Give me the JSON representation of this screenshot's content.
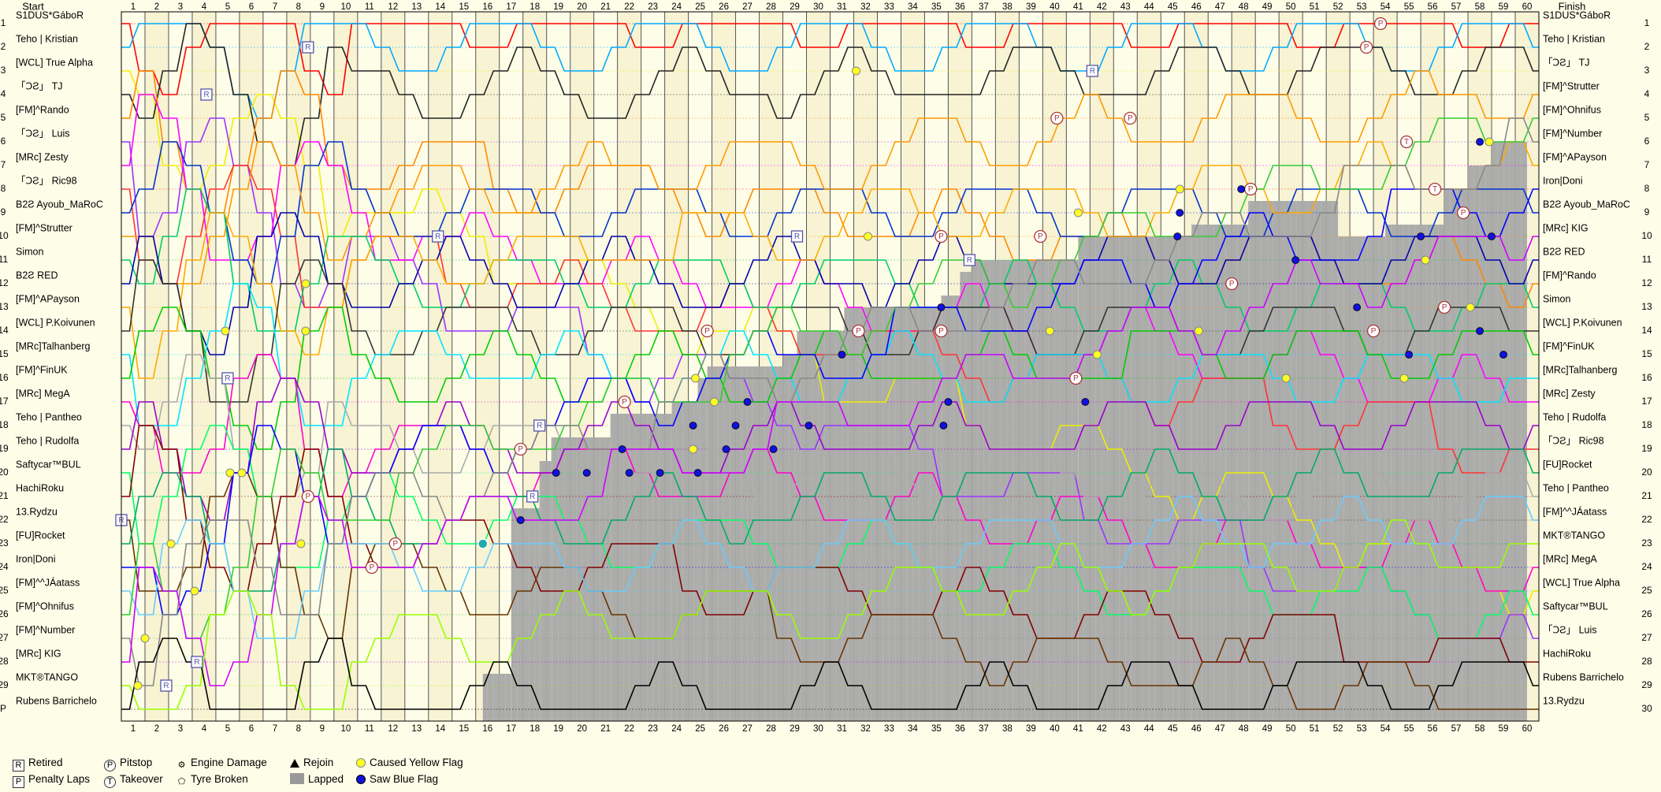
{
  "chart_data": {
    "type": "line",
    "title": "",
    "start_label": "Start",
    "finish_label": "Finish",
    "laps": 60,
    "positions": 30,
    "position_labels": [
      "1",
      "2",
      "3",
      "4",
      "5",
      "6",
      "7",
      "8",
      "9",
      "10",
      "11",
      "12",
      "13",
      "14",
      "15",
      "16",
      "17",
      "18",
      "19",
      "20",
      "21",
      "22",
      "23",
      "24",
      "25",
      "26",
      "27",
      "28",
      "29",
      "P"
    ],
    "start_grid": [
      "S1DUS*GáboR",
      "Teho | Kristian",
      "[WCL] True Alpha",
      "「ↃƧ」 TJ",
      "[FM]^Rando",
      "「ↃƧ」 Luis",
      "[MRc] Zesty",
      "「ↃƧ」 Ric98",
      "B2Ƨ Ayoub_MaRoC",
      "[FM]^Strutter",
      "Simon",
      "B2Ƨ RED",
      "[FM]^APayson",
      "[WCL] P.Koivunen",
      "[MRc]Talhanberg",
      "[FM]^FinUK",
      "[MRc] MegA",
      "Teho | Pantheo",
      "Teho | Rudolfa",
      "Saftycar™BUL",
      "HachiRoku",
      "13.Rydzu",
      "[FU]Rocket",
      "Iron|Doni",
      "[FM]^^JÁatass",
      "[FM]^Ohnifus",
      "[FM]^Number",
      "[MRc] KIG",
      "MKT®TANGO",
      "Rubens Barrichelo"
    ],
    "finish": [
      {
        "name": "S1DUS*GáboR",
        "pos": "1"
      },
      {
        "name": "Teho | Kristian",
        "pos": "2"
      },
      {
        "name": "「ↃƧ」 TJ",
        "pos": "3"
      },
      {
        "name": "[FM]^Strutter",
        "pos": "4"
      },
      {
        "name": "[FM]^Ohnifus",
        "pos": "5"
      },
      {
        "name": "[FM]^Number",
        "pos": "6"
      },
      {
        "name": "[FM]^APayson",
        "pos": "7"
      },
      {
        "name": "Iron|Doni",
        "pos": "8"
      },
      {
        "name": "B2Ƨ Ayoub_MaRoC",
        "pos": "9"
      },
      {
        "name": "[MRc] KIG",
        "pos": "10"
      },
      {
        "name": "B2Ƨ RED",
        "pos": "11"
      },
      {
        "name": "[FM]^Rando",
        "pos": "12"
      },
      {
        "name": "Simon",
        "pos": "13"
      },
      {
        "name": "[WCL] P.Koivunen",
        "pos": "14"
      },
      {
        "name": "[FM]^FinUK",
        "pos": "15"
      },
      {
        "name": "[MRc]Talhanberg",
        "pos": "16"
      },
      {
        "name": "[MRc] Zesty",
        "pos": "17"
      },
      {
        "name": "Teho | Rudolfa",
        "pos": "18"
      },
      {
        "name": "「ↃƧ」 Ric98",
        "pos": "19"
      },
      {
        "name": "[FU]Rocket",
        "pos": "20"
      },
      {
        "name": "Teho | Pantheo",
        "pos": "21"
      },
      {
        "name": "[FM]^^JÁatass",
        "pos": "22"
      },
      {
        "name": "MKT®TANGO",
        "pos": "23"
      },
      {
        "name": "[MRc] MegA",
        "pos": "24"
      },
      {
        "name": "[WCL] True Alpha",
        "pos": "25"
      },
      {
        "name": "Saftycar™BUL",
        "pos": "26"
      },
      {
        "name": "「ↃƧ」 Luis",
        "pos": "27"
      },
      {
        "name": "HachiRoku",
        "pos": "28"
      },
      {
        "name": "Rubens Barrichelo",
        "pos": "29"
      },
      {
        "name": "13.Rydzu",
        "pos": "30"
      }
    ],
    "lapped_steps": [
      {
        "from_lap": 15.3,
        "depth": 2
      },
      {
        "from_lap": 16.5,
        "depth": 9
      },
      {
        "from_lap": 17.7,
        "depth": 11
      },
      {
        "from_lap": 18.2,
        "depth": 12
      },
      {
        "from_lap": 20.7,
        "depth": 13
      },
      {
        "from_lap": 23.3,
        "depth": 13.5
      },
      {
        "from_lap": 24.4,
        "depth": 14.5
      },
      {
        "from_lap": 24.8,
        "depth": 15
      },
      {
        "from_lap": 28.0,
        "depth": 15.5
      },
      {
        "from_lap": 28.6,
        "depth": 16.5
      },
      {
        "from_lap": 30.6,
        "depth": 17.5
      },
      {
        "from_lap": 34.7,
        "depth": 18
      },
      {
        "from_lap": 35.5,
        "depth": 19
      },
      {
        "from_lap": 36.0,
        "depth": 19.5
      },
      {
        "from_lap": 40.5,
        "depth": 20.5
      },
      {
        "from_lap": 45.3,
        "depth": 21
      },
      {
        "from_lap": 47.7,
        "depth": 22
      },
      {
        "from_lap": 51.5,
        "depth": 20.5
      },
      {
        "from_lap": 53.5,
        "depth": 21
      },
      {
        "from_lap": 56.0,
        "depth": 22.5
      },
      {
        "from_lap": 57.0,
        "depth": 23.5
      },
      {
        "from_lap": 58.0,
        "depth": 24.5
      },
      {
        "from_lap": 59.5,
        "depth": 0
      }
    ],
    "events": [
      {
        "type": "pitstop",
        "lap": 53.3,
        "pos": 1
      },
      {
        "type": "pitstop",
        "lap": 52.7,
        "pos": 2
      },
      {
        "type": "retired",
        "lap": 7.9,
        "pos": 2
      },
      {
        "type": "retired",
        "lap": 3.6,
        "pos": 4
      },
      {
        "type": "retired",
        "lap": 41.1,
        "pos": 3
      },
      {
        "type": "yellow",
        "lap": 31.1,
        "pos": 3
      },
      {
        "type": "pitstop",
        "lap": 39.6,
        "pos": 5
      },
      {
        "type": "pitstop",
        "lap": 42.7,
        "pos": 5
      },
      {
        "type": "takeover",
        "lap": 54.4,
        "pos": 6
      },
      {
        "type": "blue",
        "lap": 57.5,
        "pos": 6
      },
      {
        "type": "yellow",
        "lap": 57.9,
        "pos": 6
      },
      {
        "type": "pitstop",
        "lap": 47.8,
        "pos": 8
      },
      {
        "type": "blue",
        "lap": 47.4,
        "pos": 8
      },
      {
        "type": "yellow",
        "lap": 44.8,
        "pos": 8
      },
      {
        "type": "takeover",
        "lap": 55.6,
        "pos": 8
      },
      {
        "type": "yellow",
        "lap": 40.5,
        "pos": 9
      },
      {
        "type": "blue",
        "lap": 44.8,
        "pos": 9
      },
      {
        "type": "pitstop",
        "lap": 56.8,
        "pos": 9
      },
      {
        "type": "retired",
        "lap": 13.4,
        "pos": 10
      },
      {
        "type": "retired",
        "lap": 28.6,
        "pos": 10
      },
      {
        "type": "yellow",
        "lap": 31.6,
        "pos": 10
      },
      {
        "type": "pitstop",
        "lap": 34.7,
        "pos": 10
      },
      {
        "type": "pitstop",
        "lap": 38.9,
        "pos": 10
      },
      {
        "type": "blue",
        "lap": 44.7,
        "pos": 10
      },
      {
        "type": "blue",
        "lap": 55.0,
        "pos": 10
      },
      {
        "type": "blue",
        "lap": 58.0,
        "pos": 10
      },
      {
        "type": "retired",
        "lap": 35.9,
        "pos": 11
      },
      {
        "type": "blue",
        "lap": 49.7,
        "pos": 11
      },
      {
        "type": "yellow",
        "lap": 55.2,
        "pos": 11
      },
      {
        "type": "yellow",
        "lap": 7.8,
        "pos": 12
      },
      {
        "type": "pitstop",
        "lap": 47.0,
        "pos": 12
      },
      {
        "type": "blue",
        "lap": 34.7,
        "pos": 13
      },
      {
        "type": "blue",
        "lap": 52.3,
        "pos": 13
      },
      {
        "type": "pitstop",
        "lap": 56.0,
        "pos": 13
      },
      {
        "type": "yellow",
        "lap": 57.1,
        "pos": 13
      },
      {
        "type": "yellow",
        "lap": 4.4,
        "pos": 14
      },
      {
        "type": "yellow",
        "lap": 7.8,
        "pos": 14
      },
      {
        "type": "pitstop",
        "lap": 24.8,
        "pos": 14
      },
      {
        "type": "pitstop",
        "lap": 31.2,
        "pos": 14
      },
      {
        "type": "pitstop",
        "lap": 34.7,
        "pos": 14
      },
      {
        "type": "yellow",
        "lap": 39.3,
        "pos": 14
      },
      {
        "type": "yellow",
        "lap": 45.6,
        "pos": 14
      },
      {
        "type": "pitstop",
        "lap": 53.0,
        "pos": 14
      },
      {
        "type": "blue",
        "lap": 57.5,
        "pos": 14
      },
      {
        "type": "blue",
        "lap": 30.5,
        "pos": 15
      },
      {
        "type": "yellow",
        "lap": 41.3,
        "pos": 15
      },
      {
        "type": "blue",
        "lap": 54.5,
        "pos": 15
      },
      {
        "type": "blue",
        "lap": 58.5,
        "pos": 15
      },
      {
        "type": "retired",
        "lap": 4.5,
        "pos": 16
      },
      {
        "type": "yellow",
        "lap": 24.3,
        "pos": 16
      },
      {
        "type": "pitstop",
        "lap": 40.4,
        "pos": 16
      },
      {
        "type": "yellow",
        "lap": 49.3,
        "pos": 16
      },
      {
        "type": "yellow",
        "lap": 54.3,
        "pos": 16
      },
      {
        "type": "pitstop",
        "lap": 21.3,
        "pos": 17
      },
      {
        "type": "yellow",
        "lap": 25.1,
        "pos": 17
      },
      {
        "type": "blue",
        "lap": 26.5,
        "pos": 17
      },
      {
        "type": "blue",
        "lap": 35.0,
        "pos": 17
      },
      {
        "type": "blue",
        "lap": 40.8,
        "pos": 17
      },
      {
        "type": "retired",
        "lap": 17.7,
        "pos": 18
      },
      {
        "type": "blue",
        "lap": 24.2,
        "pos": 18
      },
      {
        "type": "blue",
        "lap": 26.0,
        "pos": 18
      },
      {
        "type": "blue",
        "lap": 29.1,
        "pos": 18
      },
      {
        "type": "blue",
        "lap": 34.8,
        "pos": 18
      },
      {
        "type": "pitstop",
        "lap": 16.9,
        "pos": 19
      },
      {
        "type": "blue",
        "lap": 21.2,
        "pos": 19
      },
      {
        "type": "yellow",
        "lap": 24.2,
        "pos": 19
      },
      {
        "type": "blue",
        "lap": 25.6,
        "pos": 19
      },
      {
        "type": "blue",
        "lap": 27.6,
        "pos": 19
      },
      {
        "type": "yellow",
        "lap": 4.6,
        "pos": 20
      },
      {
        "type": "yellow",
        "lap": 5.1,
        "pos": 20
      },
      {
        "type": "blue",
        "lap": 18.4,
        "pos": 20
      },
      {
        "type": "blue",
        "lap": 19.7,
        "pos": 20
      },
      {
        "type": "blue",
        "lap": 21.5,
        "pos": 20
      },
      {
        "type": "blue",
        "lap": 22.8,
        "pos": 20
      },
      {
        "type": "blue",
        "lap": 24.4,
        "pos": 20
      },
      {
        "type": "pitstop",
        "lap": 7.9,
        "pos": 21
      },
      {
        "type": "retired",
        "lap": 17.4,
        "pos": 21
      },
      {
        "type": "blue",
        "lap": 16.9,
        "pos": 22
      },
      {
        "type": "retired",
        "lap": 0.0,
        "pos": 22
      },
      {
        "type": "yellow",
        "lap": 2.1,
        "pos": 23
      },
      {
        "type": "yellow",
        "lap": 7.6,
        "pos": 23
      },
      {
        "type": "pitstop",
        "lap": 11.6,
        "pos": 23
      },
      {
        "type": "engine",
        "lap": 15.3,
        "pos": 23
      },
      {
        "type": "pitstop",
        "lap": 10.6,
        "pos": 24
      },
      {
        "type": "yellow",
        "lap": 3.1,
        "pos": 25
      },
      {
        "type": "yellow",
        "lap": 1.0,
        "pos": 27
      },
      {
        "type": "retired",
        "lap": 3.2,
        "pos": 28
      },
      {
        "type": "yellow",
        "lap": 0.7,
        "pos": 29
      },
      {
        "type": "retired",
        "lap": 1.9,
        "pos": 29
      }
    ]
  },
  "legend": {
    "retired": "Retired",
    "penalty": "Penalty Laps",
    "pitstop": "Pitstop",
    "takeover": "Takeover",
    "engine": "Engine Damage",
    "tyre": "Tyre Broken",
    "rejoin": "Rejoin",
    "lapped": "Lapped",
    "yellow": "Caused Yellow Flag",
    "blue": "Saw Blue Flag",
    "retired_sym": "R",
    "penalty_sym": "P",
    "pitstop_sym": "P",
    "takeover_sym": "T"
  },
  "colors": {
    "background": "#fefde8",
    "grid_odd": "#f7f3d3",
    "lapped": "#a8a8a8",
    "yellow_flag": "#ffff22",
    "blue_flag": "#1111dd",
    "palette": [
      "#ff0000",
      "#00aaff",
      "#eeee00",
      "#222222",
      "#ff8800",
      "#9933ff",
      "#ff00ff",
      "#ff3333",
      "#0033cc",
      "#ff9900",
      "#00cc66",
      "#0000aa",
      "#ffaa00",
      "#333333",
      "#00e5ff",
      "#00cc00",
      "#ff00cc",
      "#aaaaaa",
      "#9900cc",
      "#00ff66",
      "#800000",
      "#663300",
      "#00aa66",
      "#0000ff",
      "#66ccff",
      "#33cc33",
      "#888888",
      "#cc00ff",
      "#99ff00",
      "#000000"
    ]
  }
}
